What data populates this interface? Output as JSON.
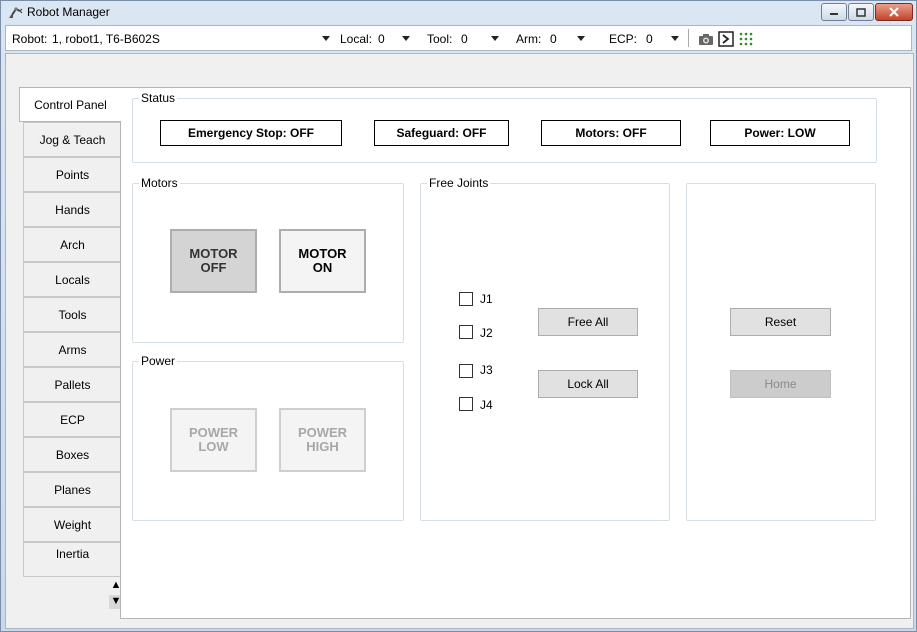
{
  "window": {
    "title": "Robot Manager"
  },
  "toolbar": {
    "robot_label": "Robot:",
    "robot_value": "1, robot1, T6-B602S",
    "local_label": "Local:",
    "local_value": "0",
    "tool_label": "Tool:",
    "tool_value": "0",
    "arm_label": "Arm:",
    "arm_value": "0",
    "ecp_label": "ECP:",
    "ecp_value": "0",
    "icons": [
      "camera-icon",
      "terminal-icon",
      "io-grid-icon"
    ]
  },
  "tabs": [
    "Control Panel",
    "Jog & Teach",
    "Points",
    "Hands",
    "Arch",
    "Locals",
    "Tools",
    "Arms",
    "Pallets",
    "ECP",
    "Boxes",
    "Planes",
    "Weight",
    "Inertia"
  ],
  "status": {
    "group_label": "Status",
    "emergency_stop": "Emergency Stop: OFF",
    "safeguard": "Safeguard: OFF",
    "motors": "Motors: OFF",
    "power": "Power: LOW"
  },
  "motors": {
    "group_label": "Motors",
    "off_line1": "MOTOR",
    "off_line2": "OFF",
    "on_line1": "MOTOR",
    "on_line2": "ON"
  },
  "power": {
    "group_label": "Power",
    "low_line1": "POWER",
    "low_line2": "LOW",
    "high_line1": "POWER",
    "high_line2": "HIGH"
  },
  "free_joints": {
    "group_label": "Free Joints",
    "joints": [
      "J1",
      "J2",
      "J3",
      "J4"
    ],
    "free_all": "Free All",
    "lock_all": "Lock All"
  },
  "misc": {
    "reset": "Reset",
    "home": "Home"
  },
  "colors": {
    "window_frame": "#c9d9ec",
    "panel_bg": "#ffffff",
    "disabled_text": "#a8a8a8"
  }
}
